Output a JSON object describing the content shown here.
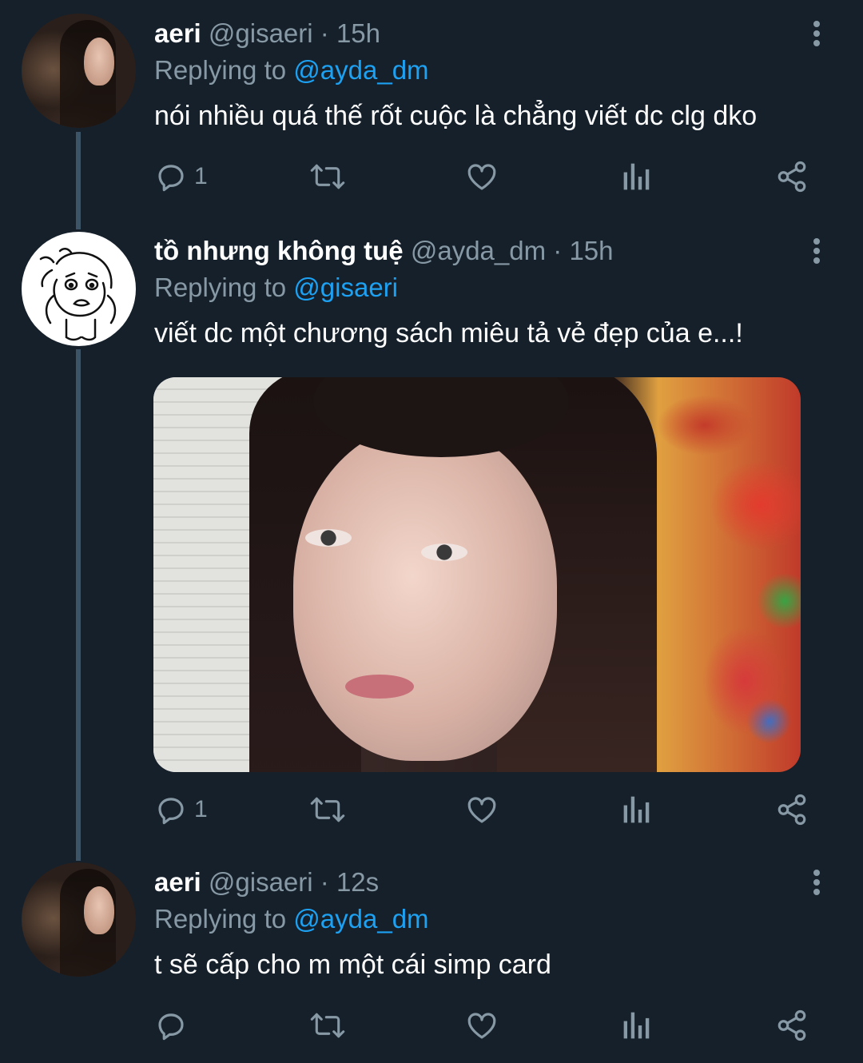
{
  "tweets": [
    {
      "name": "aeri",
      "handle": "@gisaeri",
      "dot": "·",
      "time": "15h",
      "replying_prefix": "Replying to",
      "replying_to": "@ayda_dm",
      "text": "nói nhiều quá thế rốt cuộc là chẳng viết dc clg dko",
      "reply_count": "1",
      "avatar": "photo-avatar",
      "has_media": false
    },
    {
      "name": "tồ nhưng không tuệ",
      "handle": "@ayda_dm",
      "dot": "·",
      "time": "15h",
      "replying_prefix": "Replying to",
      "replying_to": "@gisaeri",
      "text": "viết dc một chương sách miêu tả vẻ đẹp của e...!",
      "reply_count": "1",
      "avatar": "drawing-avatar",
      "has_media": true
    },
    {
      "name": "aeri",
      "handle": "@gisaeri",
      "dot": "·",
      "time": "12s",
      "replying_prefix": "Replying to",
      "replying_to": "@ayda_dm",
      "text": "t sẽ cấp cho m một cái simp card",
      "reply_count": "",
      "avatar": "photo-avatar",
      "has_media": false
    }
  ],
  "icons": {
    "reply": "reply-icon",
    "retweet": "retweet-icon",
    "like": "heart-icon",
    "analytics": "analytics-icon",
    "share": "share-icon",
    "more": "more-vertical-icon"
  },
  "colors": {
    "background": "#15202b",
    "accent": "#1da1f2",
    "secondary_text": "#8899a6",
    "thread_line": "#3d5466"
  }
}
